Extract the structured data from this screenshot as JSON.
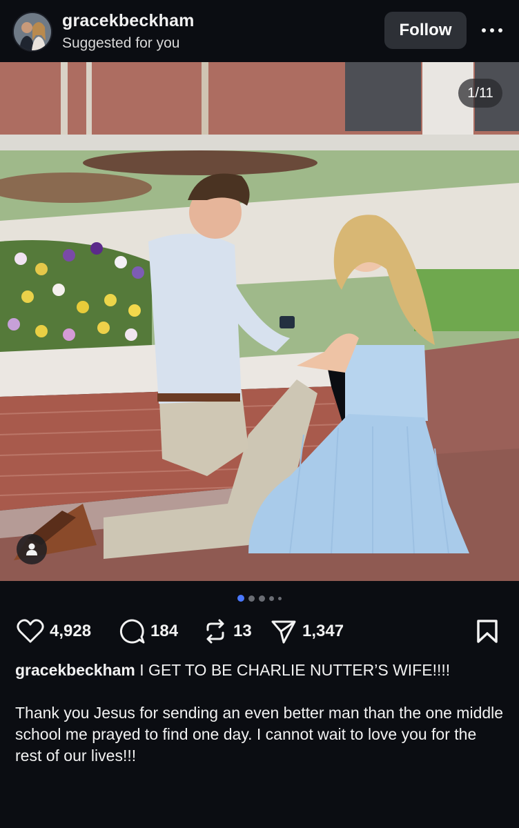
{
  "post": {
    "username": "gracekbeckham",
    "subtitle": "Suggested for you",
    "follow_label": "Follow",
    "more_icon": "more-horizontal-icon",
    "media_counter": "1/11",
    "likes": "4,928",
    "comments": "184",
    "reposts": "13",
    "shares": "1,347",
    "caption_headline": "I GET TO BE CHARLIE NUTTER’S WIFE!!!!",
    "caption_body": "Thank you Jesus for sending an even better man than the one middle school me prayed to find one day. I cannot wait to love you for the rest of our lives!!!"
  },
  "carousel": {
    "total": 11,
    "active_index": 1
  },
  "colors": {
    "background": "#0b0d12",
    "follow_button": "#2d3036",
    "active_dot": "#4a78ff"
  }
}
